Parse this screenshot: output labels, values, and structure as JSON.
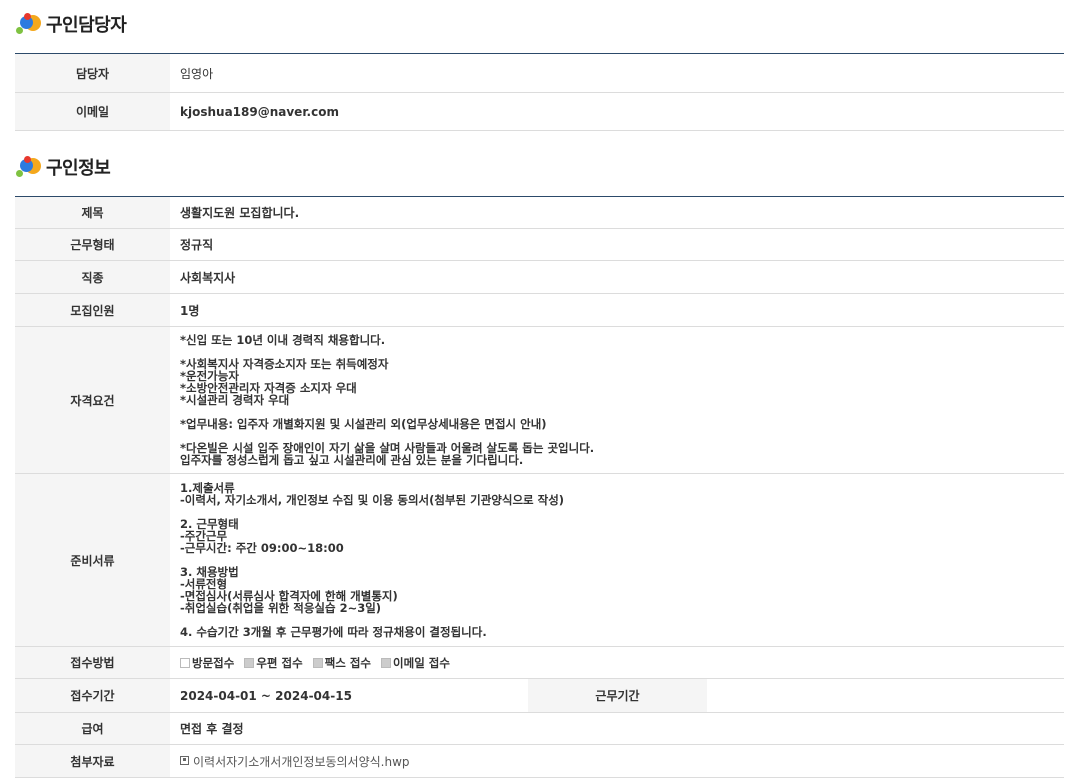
{
  "contact_section": {
    "title": "구인담당자",
    "manager_label": "담당자",
    "manager_value": "임영아",
    "email_label": "이메일",
    "email_value": "kjoshua189@naver.com"
  },
  "job_section": {
    "title": "구인정보",
    "subject_label": "제목",
    "subject_value": "생활지도원 모집합니다.",
    "work_type_label": "근무형태",
    "work_type_value": "정규직",
    "job_type_label": "직종",
    "job_type_value": "사회복지사",
    "headcount_label": "모집인원",
    "headcount_value": "1명",
    "qualifications_label": "자격요건",
    "qualifications_value": "*신입 또는 10년 이내 경력직 채용합니다.\n\n*사회복지사 자격증소지자 또는 취득예정자\n*운전가능자\n*소방안전관리자 자격증 소지자 우대\n*시설관리 경력자 우대\n\n*업무내용: 입주자 개별화지원 및 시설관리 외(업무상세내용은 면접시 안내)\n\n*다온빌은 시설 입주 장애인이 자기 삶을 살며 사람들과 어울려 살도록 돕는 곳입니다.\n입주자를 정성스럽게 돕고 싶고 시설관리에 관심 있는 분을 기다립니다.",
    "documents_label": "준비서류",
    "documents_value": "1.제출서류\n-이력서, 자기소개서, 개인정보 수집 및 이용 동의서(첨부된 기관양식으로 작성)\n\n2. 근무형태\n-주간근무\n-근무시간: 주간 09:00~18:00\n\n3. 채용방법\n-서류전형\n-면접심사(서류심사 합격자에 한해 개별통지)\n-취업실습(취업을 위한 적응실습 2~3일)\n\n4. 수습기간 3개월 후 근무평가에 따라 정규채용이 결정됩니다.",
    "method_label": "접수방법",
    "methods": [
      {
        "label": "방문접수",
        "checked": false
      },
      {
        "label": "우편 접수",
        "checked": true
      },
      {
        "label": "팩스 접수",
        "checked": true
      },
      {
        "label": "이메일 접수",
        "checked": true
      }
    ],
    "period_label": "접수기간",
    "period_value": "2024-04-01 ~ 2024-04-15",
    "work_period_label": "근무기간",
    "work_period_value": "",
    "salary_label": "급여",
    "salary_value": "면접 후 결정",
    "attachment_label": "첨부자료",
    "attachment_name": "이력서자기소개서개인정보동의서양식.hwp"
  }
}
